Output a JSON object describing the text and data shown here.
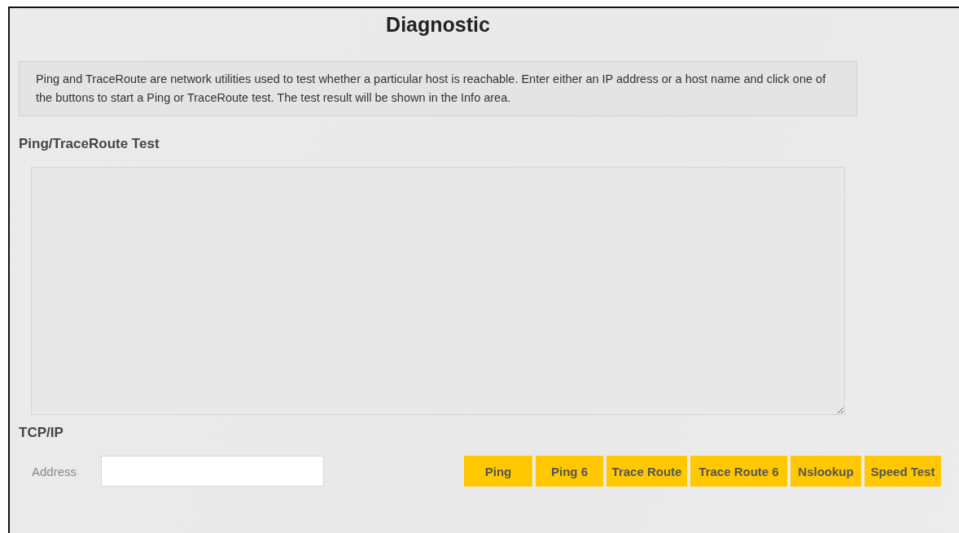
{
  "title": "Diagnostic",
  "info": "Ping and TraceRoute are network utilities used to test whether a particular host is reachable. Enter either an IP address or a host name and click one of the buttons to start a Ping or TraceRoute test. The test result will be shown in the Info area.",
  "test_section": {
    "heading": "Ping/TraceRoute Test"
  },
  "tcpip": {
    "heading": "TCP/IP",
    "address_label": "Address"
  },
  "buttons": [
    "Ping",
    "Ping 6",
    "Trace Route",
    "Trace Route 6",
    "Nslookup",
    "Speed Test"
  ]
}
